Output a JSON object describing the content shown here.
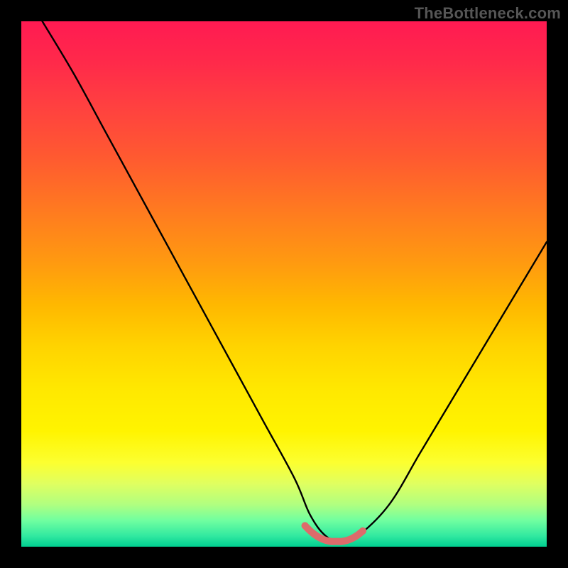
{
  "watermark": "TheBottleneck.com",
  "chart_data": {
    "type": "line",
    "title": "",
    "xlabel": "",
    "ylabel": "",
    "xlim": [
      0,
      100
    ],
    "ylim": [
      0,
      100
    ],
    "grid": false,
    "series": [
      {
        "name": "bottleneck-curve",
        "color": "#000000",
        "x": [
          4,
          10,
          16,
          22,
          28,
          34,
          40,
          46,
          52,
          55,
          58,
          61,
          64,
          70,
          76,
          82,
          88,
          94,
          100
        ],
        "y": [
          100,
          90,
          79,
          68,
          57,
          46,
          35,
          24,
          13,
          6,
          2,
          1,
          2,
          8,
          18,
          28,
          38,
          48,
          58
        ]
      },
      {
        "name": "optimal-zone",
        "color": "#e06868",
        "x": [
          54,
          55,
          56,
          57,
          58,
          59,
          60,
          61,
          62,
          63,
          64,
          65
        ],
        "y": [
          4.0,
          3.0,
          2.2,
          1.6,
          1.2,
          1.0,
          1.0,
          1.0,
          1.2,
          1.6,
          2.2,
          3.0
        ]
      }
    ],
    "gradient_stops": [
      {
        "pos": 0,
        "color": "#ff1a52"
      },
      {
        "pos": 50,
        "color": "#ffc800"
      },
      {
        "pos": 85,
        "color": "#f8ff40"
      },
      {
        "pos": 100,
        "color": "#00d090"
      }
    ]
  }
}
